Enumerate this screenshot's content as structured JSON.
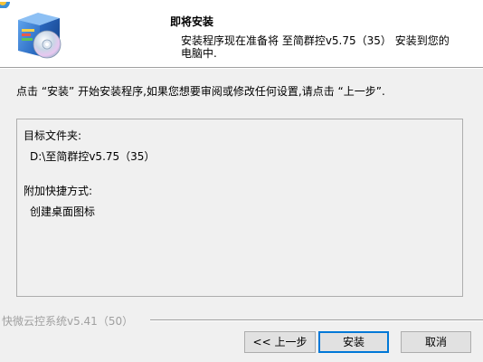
{
  "window": {
    "icon": "app-icon"
  },
  "header": {
    "image_icon": "installer-box-cd-icon",
    "title": "即将安装",
    "description_line1": "安装程序现在准备将 至简群控v5.75（35） 安装到您的",
    "description_line2": "电脑中."
  },
  "instructions": "点击 “安装” 开始安装程序,如果您想要审阅或修改任何设置,请点击 “上一步”.",
  "summary": {
    "dest_label": "目标文件夹:",
    "dest_value": "D:\\至简群控v5.75（35）",
    "shortcut_label": "附加快捷方式:",
    "shortcut_value": "创建桌面图标"
  },
  "footer": {
    "brand": "快微云控系统v5.41（50）"
  },
  "buttons": {
    "back": "<< 上一步",
    "install": "安装",
    "cancel": "取消"
  },
  "colors": {
    "window_bg": "#f0f0f0",
    "header_bg": "#ffffff",
    "default_button_border": "#0078d7",
    "footer_text": "#a0a0a0"
  }
}
